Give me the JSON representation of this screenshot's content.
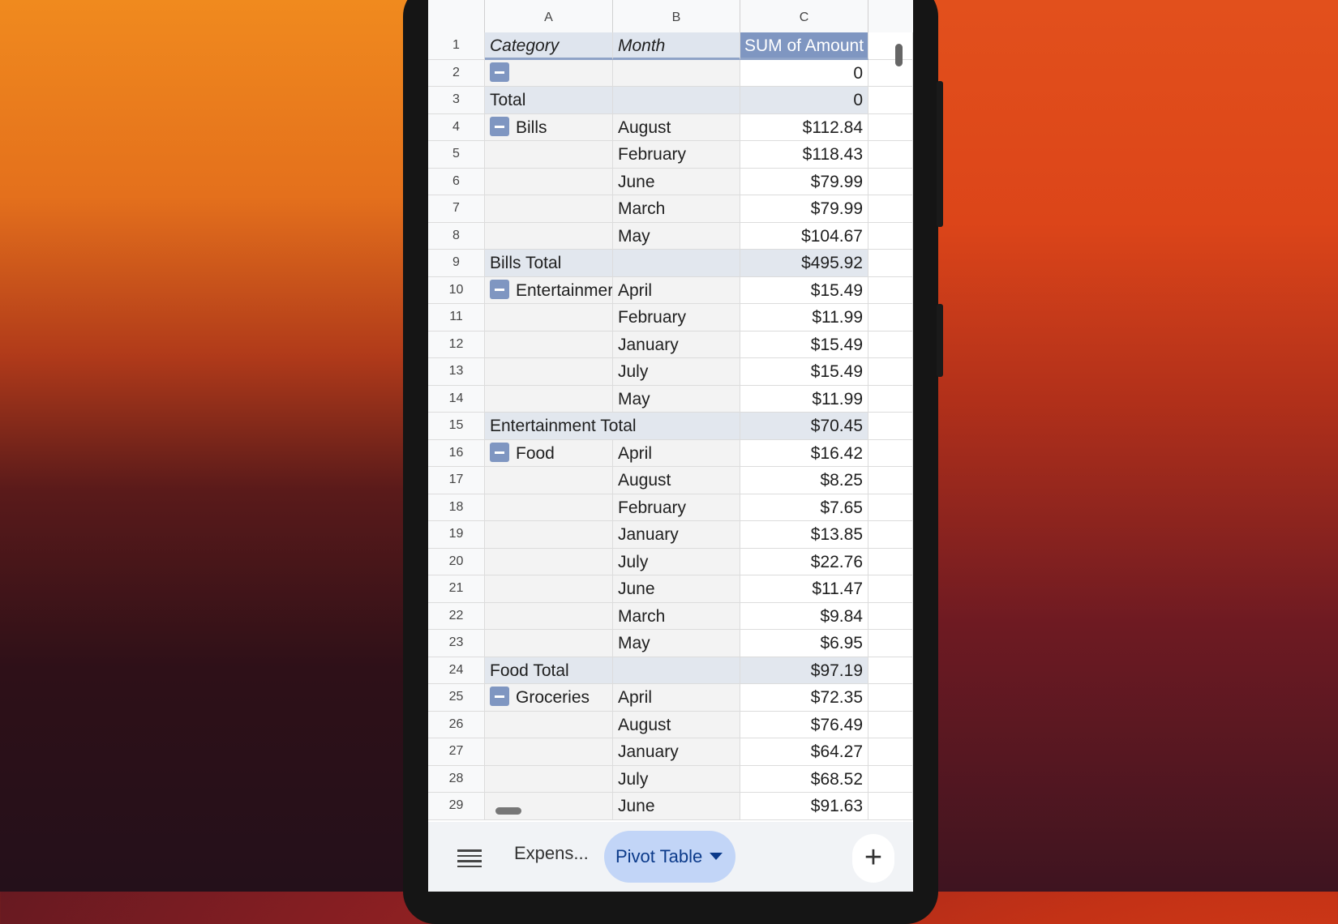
{
  "columns": [
    "A",
    "B",
    "C"
  ],
  "rows": [
    {
      "n": "1",
      "a": "Category",
      "b": "Month",
      "c": "SUM of Amount",
      "type": "header"
    },
    {
      "n": "2",
      "a": "",
      "b": "",
      "c": "0",
      "toggle": true
    },
    {
      "n": "3",
      "a": "Total",
      "b": "",
      "c": "0",
      "type": "total"
    },
    {
      "n": "4",
      "a": "Bills",
      "b": "August",
      "c": "$112.84",
      "toggle": true
    },
    {
      "n": "5",
      "a": "",
      "b": "February",
      "c": "$118.43"
    },
    {
      "n": "6",
      "a": "",
      "b": "June",
      "c": "$79.99"
    },
    {
      "n": "7",
      "a": "",
      "b": "March",
      "c": "$79.99"
    },
    {
      "n": "8",
      "a": "",
      "b": "May",
      "c": "$104.67"
    },
    {
      "n": "9",
      "a": "Bills Total",
      "b": "",
      "c": "$495.92",
      "type": "total"
    },
    {
      "n": "10",
      "a": "Entertainmer",
      "b": "April",
      "c": "$15.49",
      "toggle": true
    },
    {
      "n": "11",
      "a": "",
      "b": "February",
      "c": "$11.99"
    },
    {
      "n": "12",
      "a": "",
      "b": "January",
      "c": "$15.49"
    },
    {
      "n": "13",
      "a": "",
      "b": "July",
      "c": "$15.49"
    },
    {
      "n": "14",
      "a": "",
      "b": "May",
      "c": "$11.99"
    },
    {
      "n": "15",
      "a": "Entertainment Total",
      "b": "",
      "c": "$70.45",
      "type": "total",
      "span": true
    },
    {
      "n": "16",
      "a": "Food",
      "b": "April",
      "c": "$16.42",
      "toggle": true
    },
    {
      "n": "17",
      "a": "",
      "b": "August",
      "c": "$8.25"
    },
    {
      "n": "18",
      "a": "",
      "b": "February",
      "c": "$7.65"
    },
    {
      "n": "19",
      "a": "",
      "b": "January",
      "c": "$13.85"
    },
    {
      "n": "20",
      "a": "",
      "b": "July",
      "c": "$22.76"
    },
    {
      "n": "21",
      "a": "",
      "b": "June",
      "c": "$11.47"
    },
    {
      "n": "22",
      "a": "",
      "b": "March",
      "c": "$9.84"
    },
    {
      "n": "23",
      "a": "",
      "b": "May",
      "c": "$6.95"
    },
    {
      "n": "24",
      "a": "Food Total",
      "b": "",
      "c": "$97.19",
      "type": "total"
    },
    {
      "n": "25",
      "a": "Groceries",
      "b": "April",
      "c": "$72.35",
      "toggle": true
    },
    {
      "n": "26",
      "a": "",
      "b": "August",
      "c": "$76.49"
    },
    {
      "n": "27",
      "a": "",
      "b": "January",
      "c": "$64.27"
    },
    {
      "n": "28",
      "a": "",
      "b": "July",
      "c": "$68.52"
    },
    {
      "n": "29",
      "a": "",
      "b": "June",
      "c": "$91.63"
    }
  ],
  "bottombar": {
    "sheet_tab": "Expens...",
    "active_tab": "Pivot Table",
    "add_label": "+"
  },
  "colors": {
    "header_blue": "#7f96c1",
    "active_tab_bg": "#c2d5f7"
  }
}
